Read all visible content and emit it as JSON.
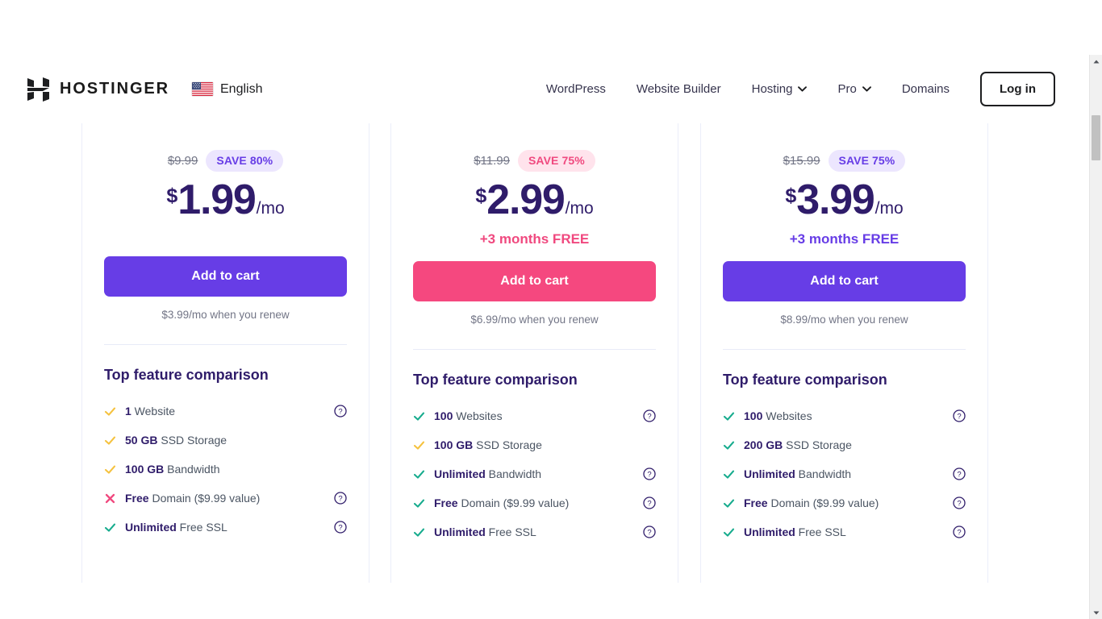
{
  "header": {
    "logo_text": "HOSTINGER",
    "logo_icon": "hostinger-h-logo",
    "language": {
      "label": "English",
      "flag_icon": "us-flag-icon"
    },
    "nav": [
      {
        "label": "WordPress",
        "has_dropdown": false
      },
      {
        "label": "Website Builder",
        "has_dropdown": false
      },
      {
        "label": "Hosting",
        "has_dropdown": true
      },
      {
        "label": "Pro",
        "has_dropdown": true
      },
      {
        "label": "Domains",
        "has_dropdown": false
      }
    ],
    "login_label": "Log in"
  },
  "colors": {
    "violet": "#673de6",
    "pink": "#f5487f",
    "pink_text": "#f0497f",
    "badge_violet_bg": "#ece6fe",
    "badge_pink_bg": "#ffe3ec",
    "heading": "#2f1c6a",
    "muted": "#727586",
    "check_green": "#18ac8e",
    "check_yellow": "#f5c23f",
    "cross_pink": "#f0497f",
    "card_border": "#ebeefa"
  },
  "plans": [
    {
      "old_price": "$9.99",
      "save_badge": "SAVE 80%",
      "badge_style": "violet",
      "currency": "$",
      "price": "1.99",
      "period": "/mo",
      "free_months": "",
      "free_months_style": "violet",
      "cta_label": "Add to cart",
      "cta_style": "violet",
      "renew_note": "$3.99/mo when you renew",
      "features_title": "Top feature comparison",
      "features": [
        {
          "icon": "check-icon",
          "icon_color": "yellow",
          "strong": "1",
          "rest": " Website",
          "help": true
        },
        {
          "icon": "check-icon",
          "icon_color": "yellow",
          "strong": "50 GB",
          "rest": " SSD Storage",
          "help": false
        },
        {
          "icon": "check-icon",
          "icon_color": "yellow",
          "strong": "100 GB",
          "rest": " Bandwidth",
          "help": false
        },
        {
          "icon": "cross-icon",
          "icon_color": "pink",
          "strong": "Free",
          "rest": " Domain ($9.99 value)",
          "help": true
        },
        {
          "icon": "check-icon",
          "icon_color": "green",
          "strong": "Unlimited",
          "rest": " Free SSL",
          "help": true
        }
      ]
    },
    {
      "old_price": "$11.99",
      "save_badge": "SAVE 75%",
      "badge_style": "pink",
      "currency": "$",
      "price": "2.99",
      "period": "/mo",
      "free_months": "+3 months FREE",
      "free_months_style": "pink",
      "cta_label": "Add to cart",
      "cta_style": "pink",
      "renew_note": "$6.99/mo when you renew",
      "features_title": "Top feature comparison",
      "features": [
        {
          "icon": "check-icon",
          "icon_color": "green",
          "strong": "100",
          "rest": " Websites",
          "help": true
        },
        {
          "icon": "check-icon",
          "icon_color": "yellow",
          "strong": "100 GB",
          "rest": " SSD Storage",
          "help": false
        },
        {
          "icon": "check-icon",
          "icon_color": "green",
          "strong": "Unlimited",
          "rest": " Bandwidth",
          "help": true
        },
        {
          "icon": "check-icon",
          "icon_color": "green",
          "strong": "Free",
          "rest": " Domain ($9.99 value)",
          "help": true
        },
        {
          "icon": "check-icon",
          "icon_color": "green",
          "strong": "Unlimited",
          "rest": " Free SSL",
          "help": true
        }
      ]
    },
    {
      "old_price": "$15.99",
      "save_badge": "SAVE 75%",
      "badge_style": "violet",
      "currency": "$",
      "price": "3.99",
      "period": "/mo",
      "free_months": "+3 months FREE",
      "free_months_style": "violet",
      "cta_label": "Add to cart",
      "cta_style": "violet",
      "renew_note": "$8.99/mo when you renew",
      "features_title": "Top feature comparison",
      "features": [
        {
          "icon": "check-icon",
          "icon_color": "green",
          "strong": "100",
          "rest": " Websites",
          "help": true
        },
        {
          "icon": "check-icon",
          "icon_color": "green",
          "strong": "200 GB",
          "rest": " SSD Storage",
          "help": false
        },
        {
          "icon": "check-icon",
          "icon_color": "green",
          "strong": "Unlimited",
          "rest": " Bandwidth",
          "help": true
        },
        {
          "icon": "check-icon",
          "icon_color": "green",
          "strong": "Free",
          "rest": " Domain ($9.99 value)",
          "help": true
        },
        {
          "icon": "check-icon",
          "icon_color": "green",
          "strong": "Unlimited",
          "rest": " Free SSL",
          "help": true
        }
      ]
    }
  ]
}
